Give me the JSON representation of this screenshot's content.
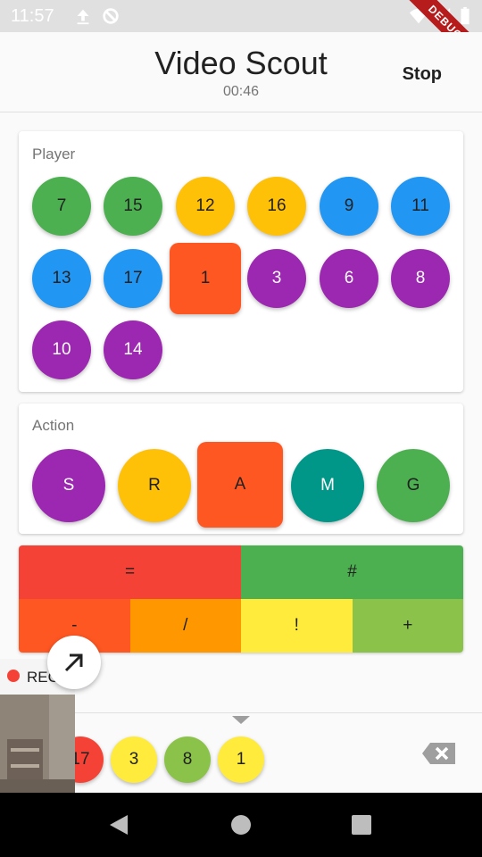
{
  "status_bar": {
    "time": "11:57",
    "debug_label": "DEBUG"
  },
  "app_bar": {
    "title": "Video Scout",
    "timer": "00:46",
    "stop_label": "Stop"
  },
  "player_card": {
    "title": "Player",
    "players": [
      {
        "number": "7",
        "color": "#4caf50",
        "text_color": "#212121",
        "selected": false
      },
      {
        "number": "15",
        "color": "#4caf50",
        "text_color": "#212121",
        "selected": false
      },
      {
        "number": "12",
        "color": "#ffc107",
        "text_color": "#212121",
        "selected": false
      },
      {
        "number": "16",
        "color": "#ffc107",
        "text_color": "#212121",
        "selected": false
      },
      {
        "number": "9",
        "color": "#2196f3",
        "text_color": "#212121",
        "selected": false
      },
      {
        "number": "11",
        "color": "#2196f3",
        "text_color": "#212121",
        "selected": false
      },
      {
        "number": "13",
        "color": "#2196f3",
        "text_color": "#212121",
        "selected": false
      },
      {
        "number": "17",
        "color": "#2196f3",
        "text_color": "#212121",
        "selected": false
      },
      {
        "number": "1",
        "color": "#ff5722",
        "text_color": "#212121",
        "selected": true
      },
      {
        "number": "3",
        "color": "#9c27b0",
        "text_color": "#ffffff",
        "selected": false
      },
      {
        "number": "6",
        "color": "#9c27b0",
        "text_color": "#ffffff",
        "selected": false
      },
      {
        "number": "8",
        "color": "#9c27b0",
        "text_color": "#ffffff",
        "selected": false
      },
      {
        "number": "10",
        "color": "#9c27b0",
        "text_color": "#ffffff",
        "selected": false
      },
      {
        "number": "14",
        "color": "#9c27b0",
        "text_color": "#ffffff",
        "selected": false
      }
    ]
  },
  "action_card": {
    "title": "Action",
    "actions": [
      {
        "label": "S",
        "color": "#9c27b0",
        "text_color": "#ffffff",
        "selected": false
      },
      {
        "label": "R",
        "color": "#ffc107",
        "text_color": "#212121",
        "selected": false
      },
      {
        "label": "A",
        "color": "#ff5722",
        "text_color": "#212121",
        "selected": true
      },
      {
        "label": "M",
        "color": "#009688",
        "text_color": "#ffffff",
        "selected": false
      },
      {
        "label": "G",
        "color": "#4caf50",
        "text_color": "#212121",
        "selected": false
      }
    ]
  },
  "evaluation_grid": {
    "top_row": [
      {
        "label": "=",
        "color": "#f44336"
      },
      {
        "label": "#",
        "color": "#4caf50"
      }
    ],
    "bottom_row": [
      {
        "label": "-",
        "color": "#ff5722"
      },
      {
        "label": "/",
        "color": "#ff9800"
      },
      {
        "label": "!",
        "color": "#ffeb3b"
      },
      {
        "label": "+",
        "color": "#8bc34a"
      }
    ]
  },
  "camera_preview": {
    "rec_label": "REC"
  },
  "history": [
    {
      "label": "17",
      "color": "#f44336"
    },
    {
      "label": "3",
      "color": "#ffeb3b"
    },
    {
      "label": "8",
      "color": "#8bc34a"
    },
    {
      "label": "1",
      "color": "#ffeb3b"
    }
  ],
  "icons": {
    "expand": "north-east-arrow-icon",
    "backspace": "backspace-icon",
    "nav_back": "triangle-back-icon",
    "nav_home": "circle-home-icon",
    "nav_recents": "square-recents-icon"
  }
}
